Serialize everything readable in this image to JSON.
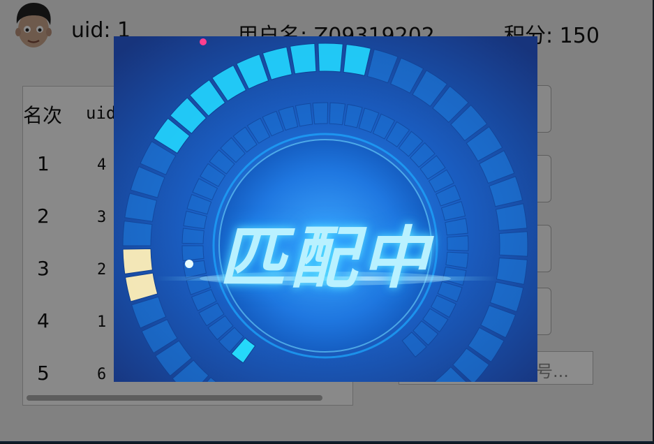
{
  "header": {
    "uid_text": "uid: 1",
    "username_text": "用户名: Z09319202",
    "score_text": "积分: 150"
  },
  "rank_table": {
    "headers": {
      "rank": "名次",
      "uid": "uid"
    },
    "rows": [
      {
        "rank": "1",
        "uid": "4"
      },
      {
        "rank": "2",
        "uid": "3"
      },
      {
        "rank": "3",
        "uid": "2"
      },
      {
        "rank": "4",
        "uid": "1"
      },
      {
        "rank": "5",
        "uid": "6"
      }
    ]
  },
  "room_input": {
    "placeholder": "号..."
  },
  "matching": {
    "label": "匹配中"
  },
  "colors": {
    "modal_bg": "#1b4a9c",
    "ring_cyan": "#1fd9ff",
    "highlight": "#fff4c0"
  },
  "icons": [
    "avatar-icon"
  ]
}
